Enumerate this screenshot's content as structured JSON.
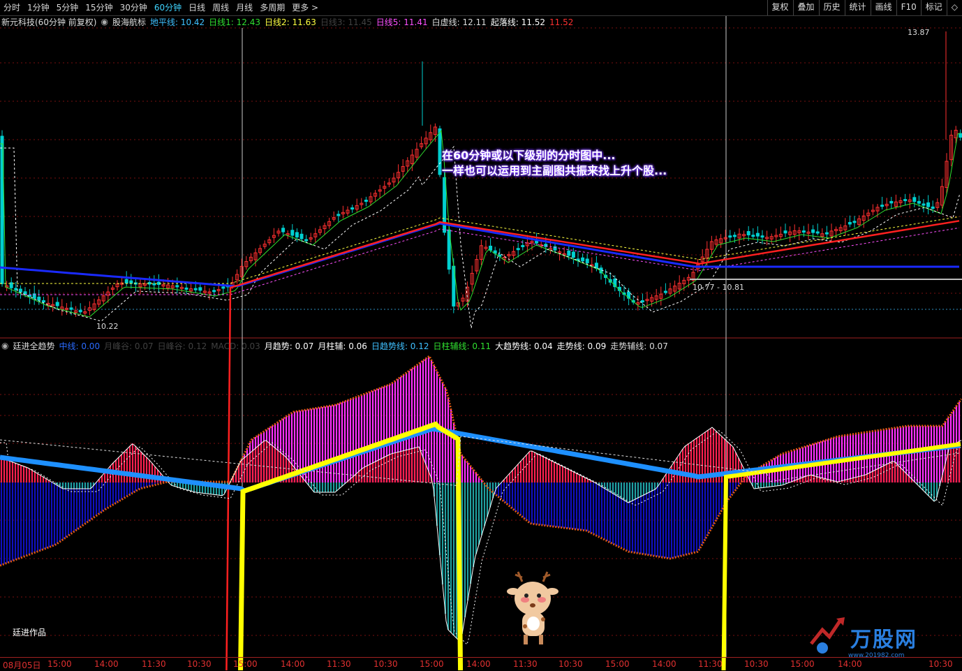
{
  "toolbar": {
    "periods": [
      {
        "label": "分时",
        "active": false
      },
      {
        "label": "1分钟",
        "active": false
      },
      {
        "label": "5分钟",
        "active": false
      },
      {
        "label": "15分钟",
        "active": false
      },
      {
        "label": "30分钟",
        "active": false
      },
      {
        "label": "60分钟",
        "active": true
      },
      {
        "label": "日线",
        "active": false
      },
      {
        "label": "周线",
        "active": false
      },
      {
        "label": "月线",
        "active": false
      },
      {
        "label": "多周期",
        "active": false
      },
      {
        "label": "更多 >",
        "active": false
      }
    ],
    "tools": [
      "复权",
      "叠加",
      "历史",
      "统计",
      "画线",
      "F10",
      "标记",
      "◇"
    ]
  },
  "main_panel": {
    "stock_title": "新元科技(60分钟 前复权)",
    "indicator_name": "股海航标",
    "indicators": [
      {
        "label": "地平线: 10.42",
        "color": "#3fc0ff"
      },
      {
        "label": "日线1: 12.43",
        "color": "#30e030"
      },
      {
        "label": "日线2: 11.63",
        "color": "#ffff40"
      },
      {
        "label": "日线3: 11.45",
        "color": "#404040"
      },
      {
        "label": "日线5: 11.41",
        "color": "#ff50ff"
      },
      {
        "label": "白虚线: 12.11",
        "color": "#dddddd"
      },
      {
        "label": "起落线: 11.52",
        "color": "#ffffff"
      },
      {
        "label": "11.52",
        "color": "#ff3030"
      }
    ],
    "max_label": "13.87",
    "min_label": "10.22",
    "range_label": "10.77 - 10.81",
    "annotation_lines": [
      "在60分钟或以下级别的分时图中...",
      "一样也可以运用到主副图共振来找上升个股..."
    ]
  },
  "sub_panel": {
    "indicator_name": "廷进全趋势",
    "indicators": [
      {
        "label": "中线: 0.00",
        "color": "#2a6bff"
      },
      {
        "label": "月峰谷: 0.07",
        "color": "#404040"
      },
      {
        "label": "日峰谷: 0.12",
        "color": "#404040"
      },
      {
        "label": "MACD: 0.03",
        "color": "#404040"
      },
      {
        "label": "月趋势: 0.07",
        "color": "#ffffff"
      },
      {
        "label": "月柱辅: 0.06",
        "color": "#ffffff"
      },
      {
        "label": "日趋势线: 0.12",
        "color": "#3fc0ff"
      },
      {
        "label": "日柱辅线: 0.11",
        "color": "#30e030"
      },
      {
        "label": "大趋势线: 0.04",
        "color": "#ffffff"
      },
      {
        "label": "走势线: 0.09",
        "color": "#ffffff"
      },
      {
        "label": "走势辅线: 0.07",
        "color": "#dddddd"
      }
    ],
    "signature": "廷进作品"
  },
  "time_axis": [
    "08月05日",
    "15:00",
    "14:00",
    "11:30",
    "10:30",
    "15:00",
    "14:00",
    "11:30",
    "10:30",
    "15:00",
    "14:00",
    "11:30",
    "10:30",
    "15:00",
    "14:00",
    "11:30",
    "10:30",
    "15:00",
    "14:00",
    "10:30"
  ],
  "watermark": {
    "text": "万股网",
    "url": "www.201982.com"
  },
  "colors": {
    "up": "#ff3030",
    "down": "#00d0d0",
    "zero_axis_fill_up": "#ff2050",
    "zero_axis_fill_down": "#1010c0"
  },
  "chart_data": {
    "type": "candlestick",
    "title": "新元科技(60分钟 前复权)",
    "price_high": 13.87,
    "price_low": 10.22,
    "annotations": [
      "13.87",
      "10.22",
      "10.77 - 10.81"
    ]
  }
}
